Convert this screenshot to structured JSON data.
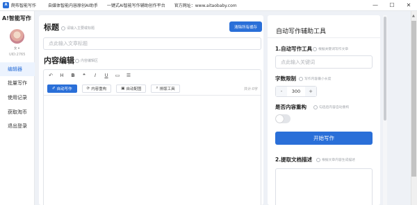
{
  "window": {
    "logo_text": "A",
    "app_name": "爬布智能写作",
    "slogan_1": "自媒体智能内容原创AI助手",
    "slogan_2": "一键式AI智能写作辅助创作平台",
    "website": "官方网址：www.aitaobaby.com",
    "minimize_icon": "minimize-icon",
    "maximize_icon": "maximize-icon",
    "close_icon": "close-icon"
  },
  "sidebar": {
    "brand": "A!智能写作",
    "gender": "女 ▾",
    "uid": "UID:2765",
    "items": [
      {
        "label": "编辑器",
        "active": true
      },
      {
        "label": "批量写作",
        "active": false
      },
      {
        "label": "使用记录",
        "active": false
      },
      {
        "label": "获取淘币",
        "active": false
      },
      {
        "label": "退出登录",
        "active": false
      }
    ]
  },
  "editor": {
    "title_label": "标题",
    "title_hint": "请输入主要或标题",
    "clear_button": "清除所有缓存",
    "title_placeholder": "点此输入文章标题",
    "content_label": "内容编辑",
    "content_hint": "内容编辑区",
    "toolbar": [
      "↶",
      "H",
      "B",
      "❝",
      "I",
      "U",
      "▭",
      "☰"
    ],
    "tools": [
      {
        "icon": "✐",
        "label": "自动写作",
        "primary": true
      },
      {
        "icon": "⟳",
        "label": "内容重构",
        "primary": false
      },
      {
        "icon": "▣",
        "label": "自动配图",
        "primary": false
      },
      {
        "icon": "⌕",
        "label": "排版工具",
        "primary": false
      }
    ],
    "word_count": "共计:0字"
  },
  "panel": {
    "title": "自动写作辅助工具",
    "section1_label": "1.自动写作工具",
    "section1_hint": "根据关键词写作文章",
    "keyword_placeholder": "点此输入关键词",
    "word_limit_label": "字数限制",
    "word_limit_hint": "写作内容最小长度",
    "word_limit_value": "300",
    "minus": "-",
    "plus": "+",
    "rebuild_label": "是否内容重构",
    "rebuild_hint": "勾选后内容自动重构",
    "rebuild_enabled": false,
    "start_button": "开始写作",
    "section2_label": "2.提取文档描述",
    "section2_hint": "根据文章内容生成描述"
  },
  "colors": {
    "accent": "#2a6fd8",
    "background": "#eef1f6"
  }
}
